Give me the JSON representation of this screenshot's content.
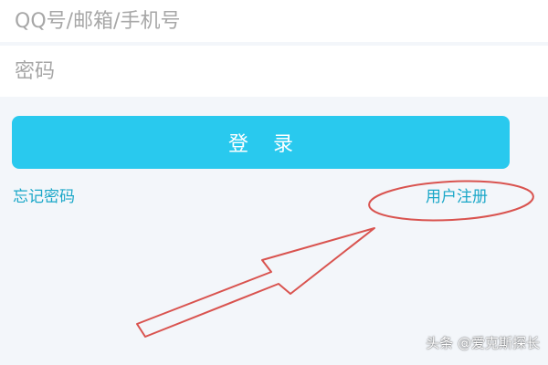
{
  "form": {
    "account_placeholder": "QQ号/邮箱/手机号",
    "password_placeholder": "密码",
    "login_label": "登 录",
    "forgot_label": "忘记密码",
    "register_label": "用户注册"
  },
  "watermark": "头条 @爱克斯探长",
  "colors": {
    "background": "#f3f6fa",
    "field_background": "#ffffff",
    "button": "#29c9ee",
    "link": "#1aa7c8",
    "annotation": "#d9534f"
  }
}
